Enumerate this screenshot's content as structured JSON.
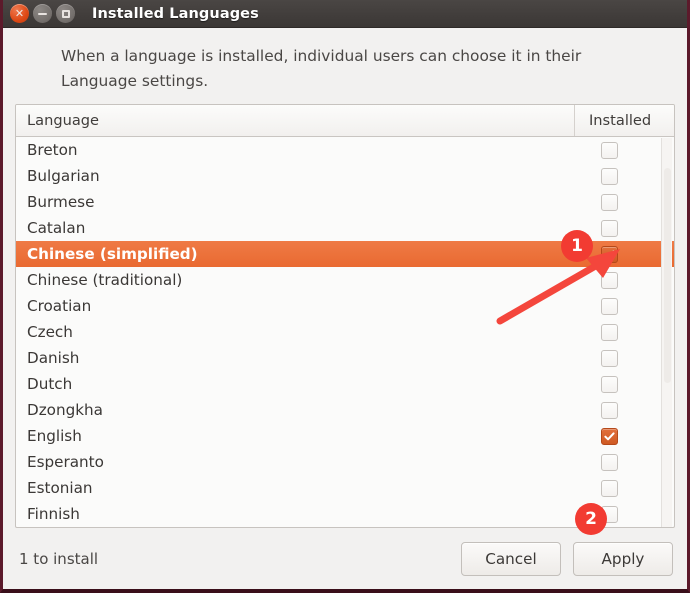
{
  "window": {
    "title": "Installed Languages",
    "controls": {
      "close": "close-icon",
      "minimize": "minimize-icon",
      "maximize": "maximize-icon"
    }
  },
  "description": "When a language is installed, individual users can choose it in their Language settings.",
  "list": {
    "headers": {
      "language": "Language",
      "installed": "Installed"
    },
    "rows": [
      {
        "name": "Breton",
        "installed": false,
        "selected": false
      },
      {
        "name": "Bulgarian",
        "installed": false,
        "selected": false
      },
      {
        "name": "Burmese",
        "installed": false,
        "selected": false
      },
      {
        "name": "Catalan",
        "installed": false,
        "selected": false
      },
      {
        "name": "Chinese (simplified)",
        "installed": true,
        "selected": true
      },
      {
        "name": "Chinese (traditional)",
        "installed": false,
        "selected": false
      },
      {
        "name": "Croatian",
        "installed": false,
        "selected": false
      },
      {
        "name": "Czech",
        "installed": false,
        "selected": false
      },
      {
        "name": "Danish",
        "installed": false,
        "selected": false
      },
      {
        "name": "Dutch",
        "installed": false,
        "selected": false
      },
      {
        "name": "Dzongkha",
        "installed": false,
        "selected": false
      },
      {
        "name": "English",
        "installed": true,
        "selected": false
      },
      {
        "name": "Esperanto",
        "installed": false,
        "selected": false
      },
      {
        "name": "Estonian",
        "installed": false,
        "selected": false
      },
      {
        "name": "Finnish",
        "installed": false,
        "selected": false
      }
    ]
  },
  "footer": {
    "status": "1 to install",
    "cancel_label": "Cancel",
    "apply_label": "Apply"
  },
  "annotations": [
    {
      "number": "1"
    },
    {
      "number": "2"
    }
  ],
  "colors": {
    "selection": "#ec7038",
    "checkbox_checked": "#d9632c",
    "annotation": "#f23b32",
    "titlebar": "#413d3b",
    "window_border": "#5c1a2b"
  }
}
